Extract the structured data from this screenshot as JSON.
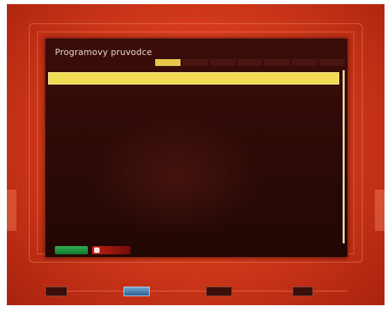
{
  "title": "Programovy pruvodce",
  "tabs": [
    {
      "label": "",
      "active": true
    },
    {
      "label": "",
      "active": false
    },
    {
      "label": "",
      "active": false
    },
    {
      "label": "",
      "active": false
    },
    {
      "label": "",
      "active": false
    },
    {
      "label": "",
      "active": false
    },
    {
      "label": "",
      "active": false
    }
  ],
  "programmes": [
    {
      "time": "",
      "name": "",
      "selected": true
    },
    {
      "time": "",
      "name": "",
      "selected": false
    },
    {
      "time": "",
      "name": "",
      "selected": false
    },
    {
      "time": "",
      "name": "",
      "selected": false
    },
    {
      "time": "",
      "name": "",
      "selected": false
    },
    {
      "time": "",
      "name": "",
      "selected": false
    },
    {
      "time": "",
      "name": "",
      "selected": false
    },
    {
      "time": "",
      "name": "",
      "selected": false
    },
    {
      "time": "",
      "name": "",
      "selected": false
    },
    {
      "time": "",
      "name": "",
      "selected": false
    }
  ],
  "buttons": {
    "green_label": "",
    "red_label": ""
  },
  "bottom_buttons": [
    {
      "label": "",
      "highlight": false
    },
    {
      "label": "",
      "highlight": true
    },
    {
      "label": "",
      "highlight": false
    },
    {
      "label": "",
      "highlight": false
    }
  ],
  "colors": {
    "accent": "#f1da52",
    "background": "#d63c1c",
    "panel": "#2a0906",
    "green_button": "#2fae4f",
    "red_button": "#c22014"
  }
}
